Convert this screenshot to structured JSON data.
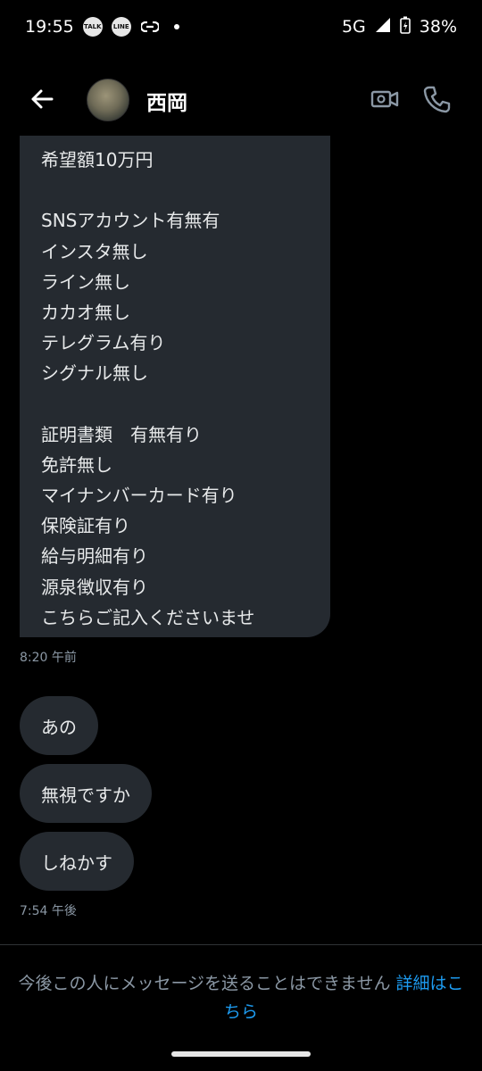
{
  "status_bar": {
    "time": "19:55",
    "notif_icons": [
      "TALK",
      "LINE"
    ],
    "network": "5G",
    "battery": "38%"
  },
  "header": {
    "contact_name": "西岡",
    "back_icon": "arrow-left-icon",
    "video_icon": "video-camera-icon",
    "call_icon": "phone-icon"
  },
  "messages": {
    "long_message_lines": [
      "希望額10万円",
      "",
      "SNSアカウント有無有",
      "インスタ無し",
      "ライン無し",
      "カカオ無し",
      "テレグラム有り",
      "シグナル無し",
      "",
      "証明書類　有無有り",
      "免許無し",
      "マイナンバーカード有り",
      "保険証有り",
      "給与明細有り",
      "源泉徴収有り",
      "こちらご記入くださいませ"
    ],
    "time_1": "8:20 午前",
    "short_messages": [
      "あの",
      "無視ですか",
      "しねかす"
    ],
    "time_2": "7:54 午後"
  },
  "footer": {
    "notice_text": "今後この人にメッセージを送ることはできません ",
    "notice_link": "詳細はこちら"
  },
  "colors": {
    "background": "#000000",
    "bubble": "#252a30",
    "link": "#1d9bf0",
    "muted_text": "#8b98a5"
  }
}
